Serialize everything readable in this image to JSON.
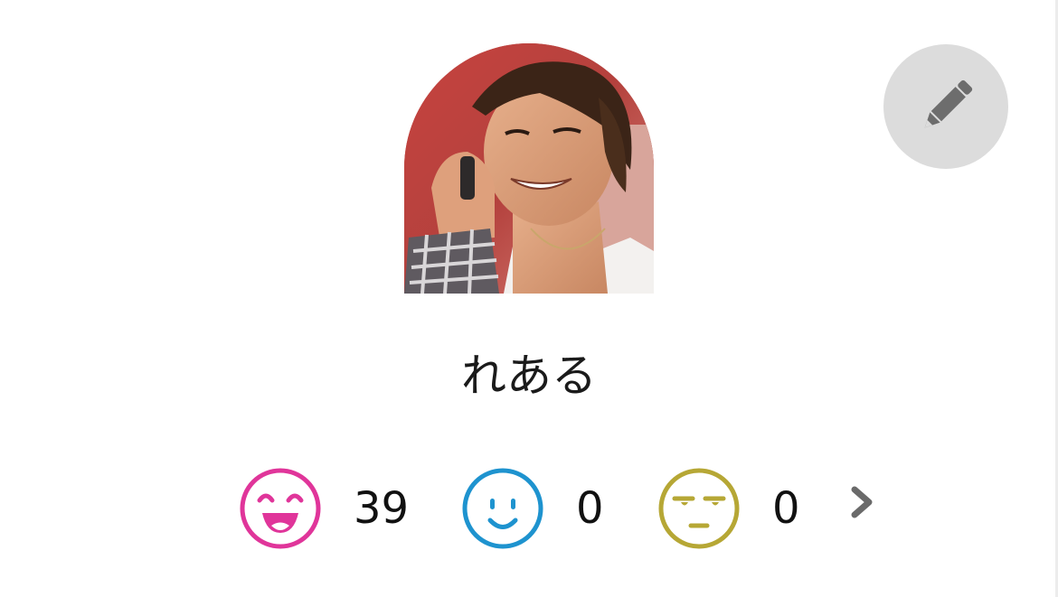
{
  "profile": {
    "name": "れある",
    "avatar_icon": "user-photo"
  },
  "actions": {
    "edit_icon": "pencil-icon"
  },
  "reactions": [
    {
      "icon": "laughing-face-icon",
      "count": "39",
      "color": "#e0359a"
    },
    {
      "icon": "smiling-face-icon",
      "count": "0",
      "color": "#1e93cf"
    },
    {
      "icon": "unamused-face-icon",
      "count": "0",
      "color": "#b6a735"
    }
  ],
  "navigation": {
    "more_icon": "chevron-right-icon"
  }
}
